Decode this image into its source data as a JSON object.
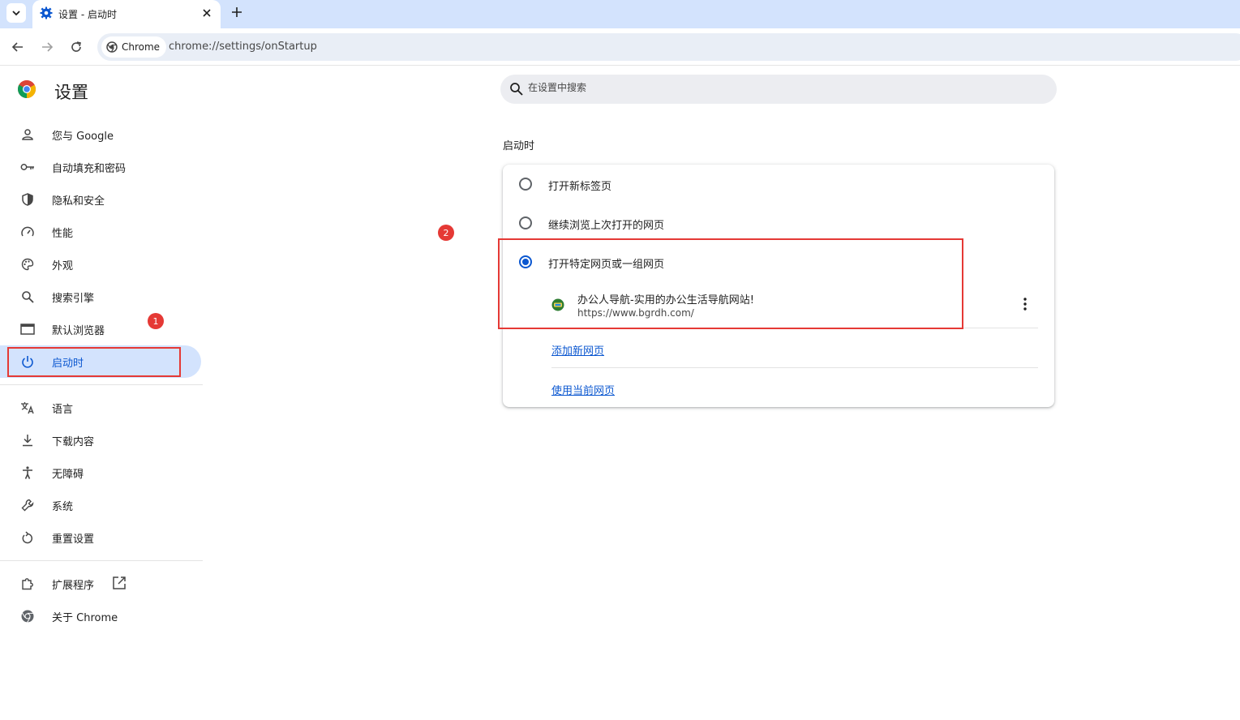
{
  "tab": {
    "title": "设置 - 启动时",
    "close_icon": "close-icon",
    "new_tab_icon": "plus-icon"
  },
  "toolbar": {
    "chip_label": "Chrome",
    "url": "chrome://settings/onStartup"
  },
  "brand": {
    "title": "设置"
  },
  "sidebar": {
    "items": [
      {
        "label": "您与 Google",
        "icon": "person-icon"
      },
      {
        "label": "自动填充和密码",
        "icon": "key-icon"
      },
      {
        "label": "隐私和安全",
        "icon": "shield-icon"
      },
      {
        "label": "性能",
        "icon": "speedometer-icon"
      },
      {
        "label": "外观",
        "icon": "palette-icon"
      },
      {
        "label": "搜索引擎",
        "icon": "search-icon"
      },
      {
        "label": "默认浏览器",
        "icon": "browser-window-icon"
      },
      {
        "label": "启动时",
        "icon": "power-icon",
        "active": true
      }
    ],
    "items2": [
      {
        "label": "语言",
        "icon": "translate-icon"
      },
      {
        "label": "下载内容",
        "icon": "download-icon"
      },
      {
        "label": "无障碍",
        "icon": "accessibility-icon"
      },
      {
        "label": "系统",
        "icon": "wrench-icon"
      },
      {
        "label": "重置设置",
        "icon": "reset-icon"
      }
    ],
    "items3": [
      {
        "label": "扩展程序",
        "icon": "extension-icon"
      },
      {
        "label": "关于 Chrome",
        "icon": "chrome-icon"
      }
    ]
  },
  "search": {
    "placeholder": "在设置中搜索"
  },
  "startup": {
    "section_title": "启动时",
    "options": [
      {
        "label": "打开新标签页",
        "checked": false
      },
      {
        "label": "继续浏览上次打开的网页",
        "checked": false
      },
      {
        "label": "打开特定网页或一组网页",
        "checked": true
      }
    ],
    "page": {
      "title": "办公人导航-实用的办公生活导航网站!",
      "url": "https://www.bgrdh.com/"
    },
    "add_page_label": "添加新网页",
    "use_current_label": "使用当前网页"
  },
  "annotations": {
    "badge1": "1",
    "badge2": "2"
  },
  "colors": {
    "accent": "#0b57d0",
    "annotation": "#e53935",
    "tabstrip": "#d3e3fd"
  }
}
